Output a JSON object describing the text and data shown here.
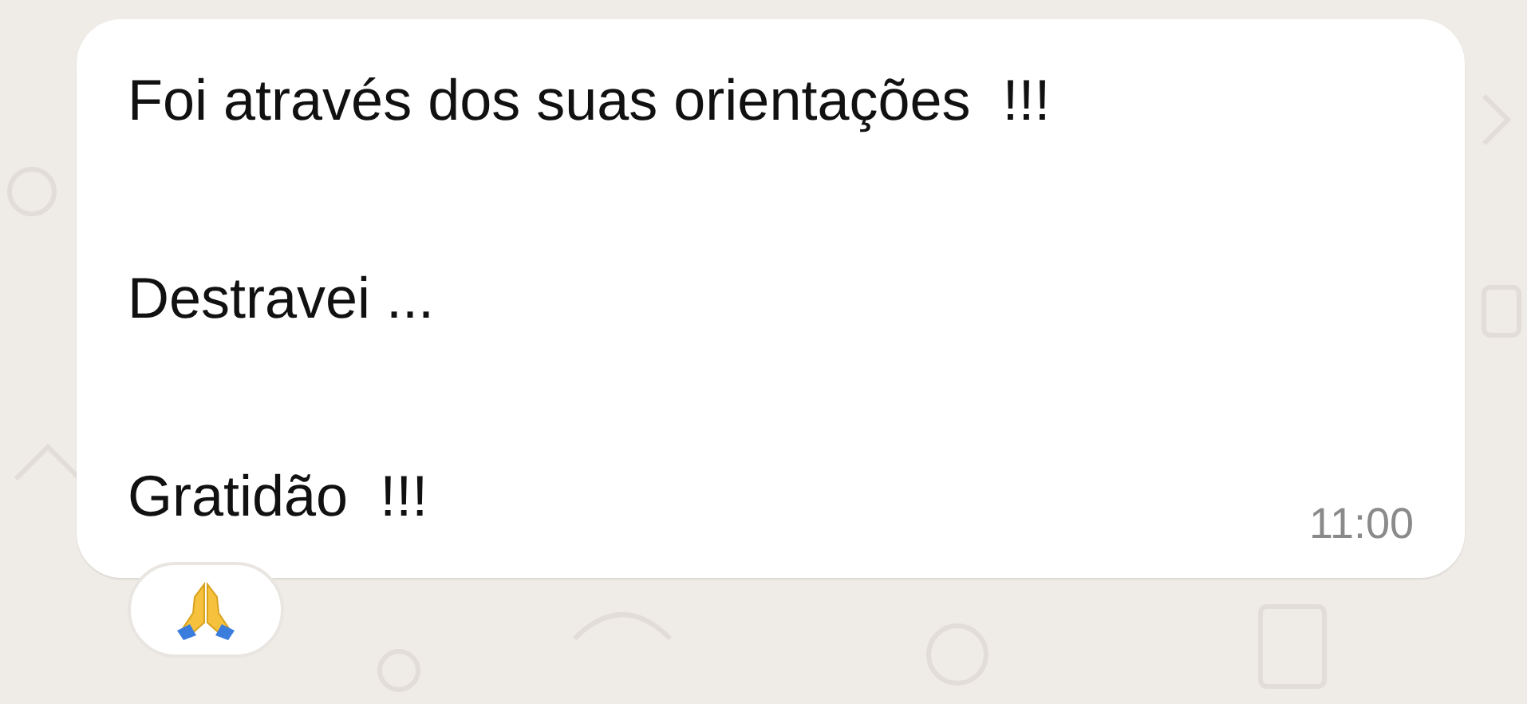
{
  "message": {
    "paragraphs": [
      "Foi através dos suas orientações  !!!",
      "Destravei ...",
      "Gratidão  !!!"
    ],
    "time": "11:00",
    "reactions": [
      {
        "kind": "pray"
      }
    ]
  }
}
